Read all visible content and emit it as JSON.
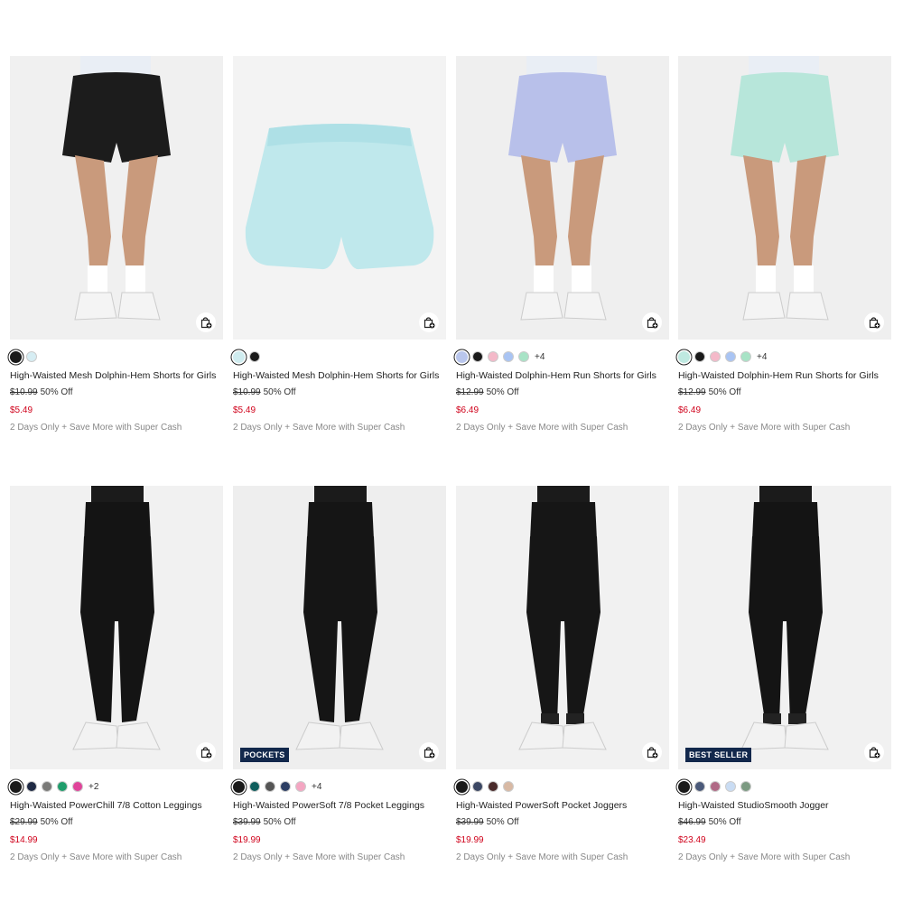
{
  "colors": {
    "sale": "#d0021b",
    "badge_bg": "#12284c",
    "muted": "#888888"
  },
  "products": [
    {
      "name": "High-Waisted Mesh Dolphin-Hem Shorts for Girls",
      "original_price": "$10.99",
      "discount": "50% Off",
      "sale_price": "$5.49",
      "promo": "2 Days Only + Save More with Super Cash",
      "swatches": [
        "#1a1a1a",
        "#d6edf3"
      ],
      "more_colors": "",
      "badge": "",
      "image": {
        "bg": "#f0f0f0",
        "garment": "#1c1c1c",
        "type": "shorts-model"
      }
    },
    {
      "name": "High-Waisted Mesh Dolphin-Hem Shorts for Girls",
      "original_price": "$10.99",
      "discount": "50% Off",
      "sale_price": "$5.49",
      "promo": "2 Days Only + Save More with Super Cash",
      "swatches": [
        "#cfecef",
        "#1a1a1a"
      ],
      "more_colors": "",
      "badge": "",
      "image": {
        "bg": "#f3f3f3",
        "garment": "#bfe8ec",
        "type": "shorts-flat"
      }
    },
    {
      "name": "High-Waisted Dolphin-Hem Run Shorts for Girls",
      "original_price": "$12.99",
      "discount": "50% Off",
      "sale_price": "$6.49",
      "promo": "2 Days Only + Save More with Super Cash",
      "swatches": [
        "#b9c6ec",
        "#1a1a1a",
        "#f4b9c9",
        "#a9c4f3",
        "#a8e3c6"
      ],
      "more_colors": "+4",
      "badge": "",
      "image": {
        "bg": "#efefef",
        "garment": "#b8c0ea",
        "type": "shorts-model"
      }
    },
    {
      "name": "High-Waisted Dolphin-Hem Run Shorts for Girls",
      "original_price": "$12.99",
      "discount": "50% Off",
      "sale_price": "$6.49",
      "promo": "2 Days Only + Save More with Super Cash",
      "swatches": [
        "#bfe9e1",
        "#1a1a1a",
        "#f4b9c9",
        "#a9c4f3",
        "#a8e3c6"
      ],
      "more_colors": "+4",
      "badge": "",
      "image": {
        "bg": "#efefef",
        "garment": "#b7e6da",
        "type": "shorts-model"
      }
    },
    {
      "name": "High-Waisted PowerChill 7/8 Cotton Leggings",
      "original_price": "$29.99",
      "discount": "50% Off",
      "sale_price": "$14.99",
      "promo": "2 Days Only + Save More with Super Cash",
      "swatches": [
        "#1a1a1a",
        "#1f2a44",
        "#7a7a78",
        "#1f9d6b",
        "#e0449a"
      ],
      "more_colors": "+2",
      "badge": "",
      "image": {
        "bg": "#f1f1f1",
        "garment": "#141414",
        "type": "leggings"
      }
    },
    {
      "name": "High-Waisted PowerSoft 7/8 Pocket Leggings",
      "original_price": "$39.99",
      "discount": "50% Off",
      "sale_price": "$19.99",
      "promo": "2 Days Only + Save More with Super Cash",
      "swatches": [
        "#1a1a1a",
        "#0f5d5c",
        "#555555",
        "#2c3e63",
        "#f4a6c2"
      ],
      "more_colors": "+4",
      "badge": "POCKETS",
      "image": {
        "bg": "#eeeeee",
        "garment": "#151515",
        "type": "leggings"
      }
    },
    {
      "name": "High-Waisted PowerSoft Pocket Joggers",
      "original_price": "$39.99",
      "discount": "50% Off",
      "sale_price": "$19.99",
      "promo": "2 Days Only + Save More with Super Cash",
      "swatches": [
        "#1a1a1a",
        "#3b4763",
        "#4a2a2a",
        "#d8b9a4"
      ],
      "more_colors": "",
      "badge": "",
      "image": {
        "bg": "#f1f1f1",
        "garment": "#161616",
        "type": "joggers"
      }
    },
    {
      "name": "High-Waisted StudioSmooth Jogger",
      "original_price": "$46.99",
      "discount": "50% Off",
      "sale_price": "$23.49",
      "promo": "2 Days Only + Save More with Super Cash",
      "swatches": [
        "#1a1a1a",
        "#4b5a7a",
        "#b06a86",
        "#c9dcf3",
        "#7c9a82"
      ],
      "more_colors": "",
      "badge": "BEST SELLER",
      "image": {
        "bg": "#f1f1f1",
        "garment": "#141414",
        "type": "joggers"
      }
    }
  ]
}
